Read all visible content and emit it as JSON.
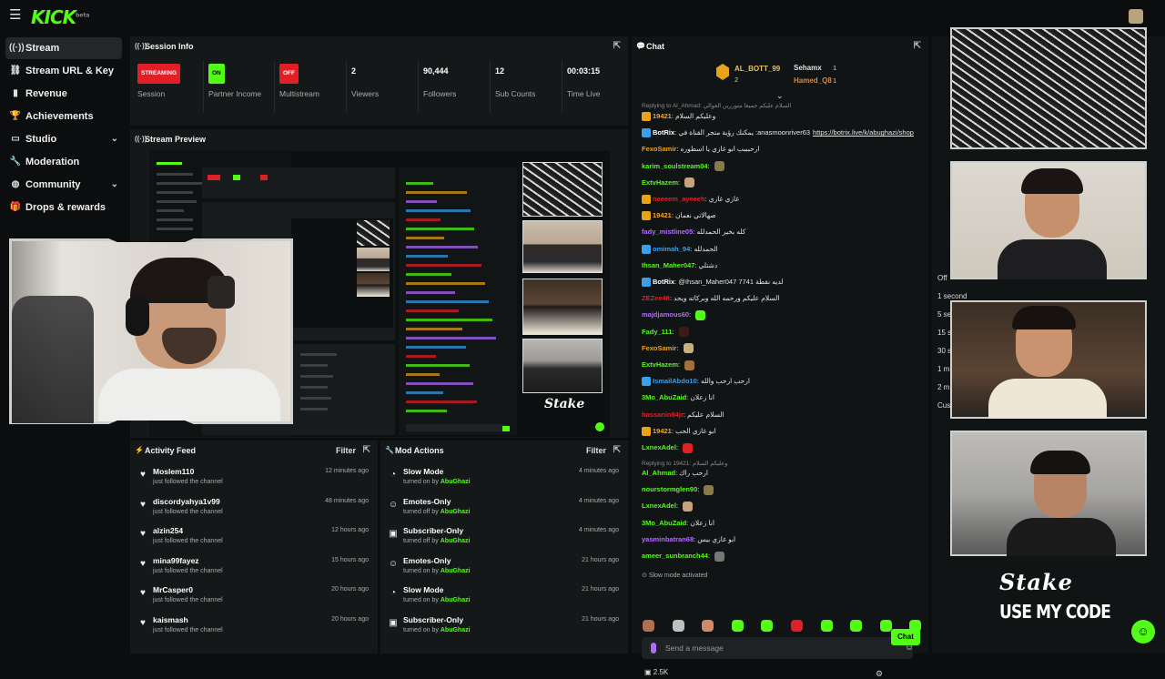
{
  "app": {
    "logo": "KICK",
    "logo_sup": "beta"
  },
  "sidebar": {
    "items": [
      {
        "label": "Stream",
        "icon": "radio-icon",
        "glyph": "((·))",
        "active": true
      },
      {
        "label": "Stream URL & Key",
        "icon": "link-icon",
        "glyph": "⛓"
      },
      {
        "label": "Revenue",
        "icon": "chart-icon",
        "glyph": "▮"
      },
      {
        "label": "Achievements",
        "icon": "trophy-icon",
        "glyph": "🏆"
      },
      {
        "label": "Studio",
        "icon": "monitor-icon",
        "glyph": "▭",
        "chevron": "⌄"
      },
      {
        "label": "Moderation",
        "icon": "wrench-icon",
        "glyph": "🔧"
      },
      {
        "label": "Community",
        "icon": "globe-icon",
        "glyph": "◍",
        "chevron": "⌄"
      },
      {
        "label": "Drops & rewards",
        "icon": "gift-icon",
        "glyph": "🎁"
      }
    ]
  },
  "session": {
    "title": "Session Info",
    "stats": [
      {
        "value": "STREAMING",
        "label": "Session",
        "type": "badge-red"
      },
      {
        "value": "ON",
        "label": "Partner Income",
        "type": "badge-green"
      },
      {
        "value": "OFF",
        "label": "Multistream",
        "type": "badge-red"
      },
      {
        "value": "2",
        "label": "Viewers"
      },
      {
        "value": "90,444",
        "label": "Followers"
      },
      {
        "value": "12",
        "label": "Sub Counts"
      },
      {
        "value": "00:03:15",
        "label": "Time Live"
      }
    ]
  },
  "preview": {
    "title": "Stream Preview",
    "stake": "Stake"
  },
  "activity": {
    "title": "Activity Feed",
    "filter": "Filter",
    "rows": [
      {
        "name": "Moslem110",
        "sub": "just followed the channel",
        "time": "12 minutes ago"
      },
      {
        "name": "discordyahya1v99",
        "sub": "just followed the channel",
        "time": "48 minutes ago"
      },
      {
        "name": "alzin254",
        "sub": "just followed the channel",
        "time": "12 hours ago"
      },
      {
        "name": "mina99fayez",
        "sub": "just followed the channel",
        "time": "15 hours ago"
      },
      {
        "name": "MrCasper0",
        "sub": "just followed the channel",
        "time": "20 hours ago"
      },
      {
        "name": "kaismash",
        "sub": "just followed the channel",
        "time": "20 hours ago"
      }
    ]
  },
  "mod": {
    "title": "Mod Actions",
    "filter": "Filter",
    "rows": [
      {
        "name": "Slow Mode",
        "pre": "turned on by",
        "by": "AbuGhazi",
        "time": "4 minutes ago",
        "icon": "clock-icon",
        "glyph": "◔"
      },
      {
        "name": "Emotes-Only",
        "pre": "turned off by",
        "by": "AbuGhazi",
        "time": "4 minutes ago",
        "icon": "smile-icon",
        "glyph": "☺"
      },
      {
        "name": "Subscriber-Only",
        "pre": "turned off by",
        "by": "AbuGhazi",
        "time": "4 minutes ago",
        "icon": "gift-icon",
        "glyph": "▣"
      },
      {
        "name": "Emotes-Only",
        "pre": "turned on by",
        "by": "AbuGhazi",
        "time": "21 hours ago",
        "icon": "smile-icon",
        "glyph": "☺"
      },
      {
        "name": "Slow Mode",
        "pre": "turned on by",
        "by": "AbuGhazi",
        "time": "21 hours ago",
        "icon": "clock-icon",
        "glyph": "◔"
      },
      {
        "name": "Subscriber-Only",
        "pre": "turned on by",
        "by": "AbuGhazi",
        "time": "21 hours ago",
        "icon": "gift-icon",
        "glyph": "▣"
      }
    ]
  },
  "chat": {
    "title": "Chat",
    "top_gifters": [
      {
        "name": "AL_BOTT_99",
        "count": "2"
      },
      {
        "name": "Sehamx",
        "count": "1"
      },
      {
        "name": "Hamed_Q8",
        "count": "1"
      }
    ],
    "reply1": "Replying to Al_Ahmad: السلام عليكم جميعا متوررين الغوالي",
    "messages": [
      {
        "user": "19421",
        "text": "وعليكم السلام",
        "color": "#f5a623",
        "badge": "#e8a317"
      },
      {
        "user": "BotRix",
        "text": "يمكنك رؤية متجر القناة في :anasmoonriver63",
        "link": "https://botrix.live/k/abughazi/shop",
        "color": "#ffffff",
        "badge": "#39a0ed"
      },
      {
        "user": "FexoSamir",
        "text": "ارحبببب ابو غازي يا اسطوره",
        "color": "#e8a317"
      },
      {
        "user": "karim_soulstream04",
        "text": "",
        "color": "#53fc18",
        "emote": "#8a7a4a"
      },
      {
        "user": "ExtvHazem",
        "text": "",
        "color": "#53fc18",
        "emote": "#c8a27c"
      },
      {
        "user": "neeeem_ayeeeh",
        "text": "غازي غازي",
        "color": "#e01f27",
        "badge": "#e8a317"
      },
      {
        "user": "19421",
        "text": "صهالاتي نعمان",
        "color": "#f5a623",
        "badge": "#e8a317"
      },
      {
        "user": "fady_mistline05",
        "text": "كله بخير الحمدلله",
        "color": "#b06bff"
      },
      {
        "user": "omimah_94",
        "text": "الحمدلله",
        "color": "#39a0ed",
        "badge": "#39a0ed"
      },
      {
        "user": "Ihsan_Maher047",
        "text": "دشتلي",
        "color": "#53fc18"
      },
      {
        "user": "BotRix",
        "text": "@Ihsan_Maher047 7741 لديه نقطة",
        "color": "#ffffff",
        "badge": "#39a0ed"
      },
      {
        "user": "ZEZee48",
        "text": "السلام عليكم ورحمه الله وبركاته ويحد",
        "color": "#e01f27"
      },
      {
        "user": "majdjamous60",
        "text": "",
        "color": "#b06bff",
        "emote": "#53fc18"
      },
      {
        "user": "Fady_111",
        "text": "",
        "color": "#53fc18",
        "emote": "#3a1a1a"
      },
      {
        "user": "FexoSamir",
        "text": "",
        "color": "#e8a317",
        "emote": "#c9b27a"
      },
      {
        "user": "ExtvHazem",
        "text": "",
        "color": "#53fc18",
        "emote": "#a07040"
      },
      {
        "user": "IsmailAbdo10",
        "text": "ارحب ارحب والله",
        "color": "#39a0ed",
        "badge": "#39a0ed"
      },
      {
        "user": "3Mo_AbuZaid",
        "text": "انا زعلان",
        "color": "#53fc18"
      },
      {
        "user": "hassanin84jr",
        "text": "السلام عليكم",
        "color": "#e01f27"
      },
      {
        "user": "19421",
        "text": "ابو غازي الحب",
        "color": "#f5a623",
        "badge": "#e8a317"
      },
      {
        "user": "LxnexAdel",
        "text": "",
        "color": "#53fc18",
        "emote": "#e01f27"
      }
    ],
    "reply2": "Replying to 19421: وعليكم السلام",
    "messages2": [
      {
        "user": "Al_Ahmad",
        "text": "ارحب راك",
        "color": "#53fc18"
      },
      {
        "user": "nourstormglen90",
        "text": "",
        "color": "#53fc18",
        "emote": "#8a7a4a"
      },
      {
        "user": "LxnexAdel",
        "text": "",
        "color": "#53fc18",
        "emote": "#c8a27c"
      },
      {
        "user": "3Mo_AbuZaid",
        "text": "انا زعلان",
        "color": "#53fc18"
      },
      {
        "user": "yasminbatran68",
        "text": "ابو غازي بيس",
        "color": "#b06bff"
      },
      {
        "user": "ameer_sunbranch44",
        "text": "",
        "color": "#53fc18",
        "emote": "#777777"
      }
    ],
    "slow_mode": "Slow mode activated",
    "placeholder": "Send a message",
    "points": "2.5K",
    "send": "Chat"
  },
  "overlay": {
    "stake": "Stake",
    "code": "USE MY CODE"
  },
  "right_partial": [
    "Off",
    "1 second",
    "5 se",
    "15 s",
    "30 s",
    "1 mi",
    "2 m",
    "Custom"
  ],
  "colors": {
    "accent": "#53fc18",
    "danger": "#e01f27",
    "bg": "#0b0d0e",
    "panel": "#151819"
  }
}
